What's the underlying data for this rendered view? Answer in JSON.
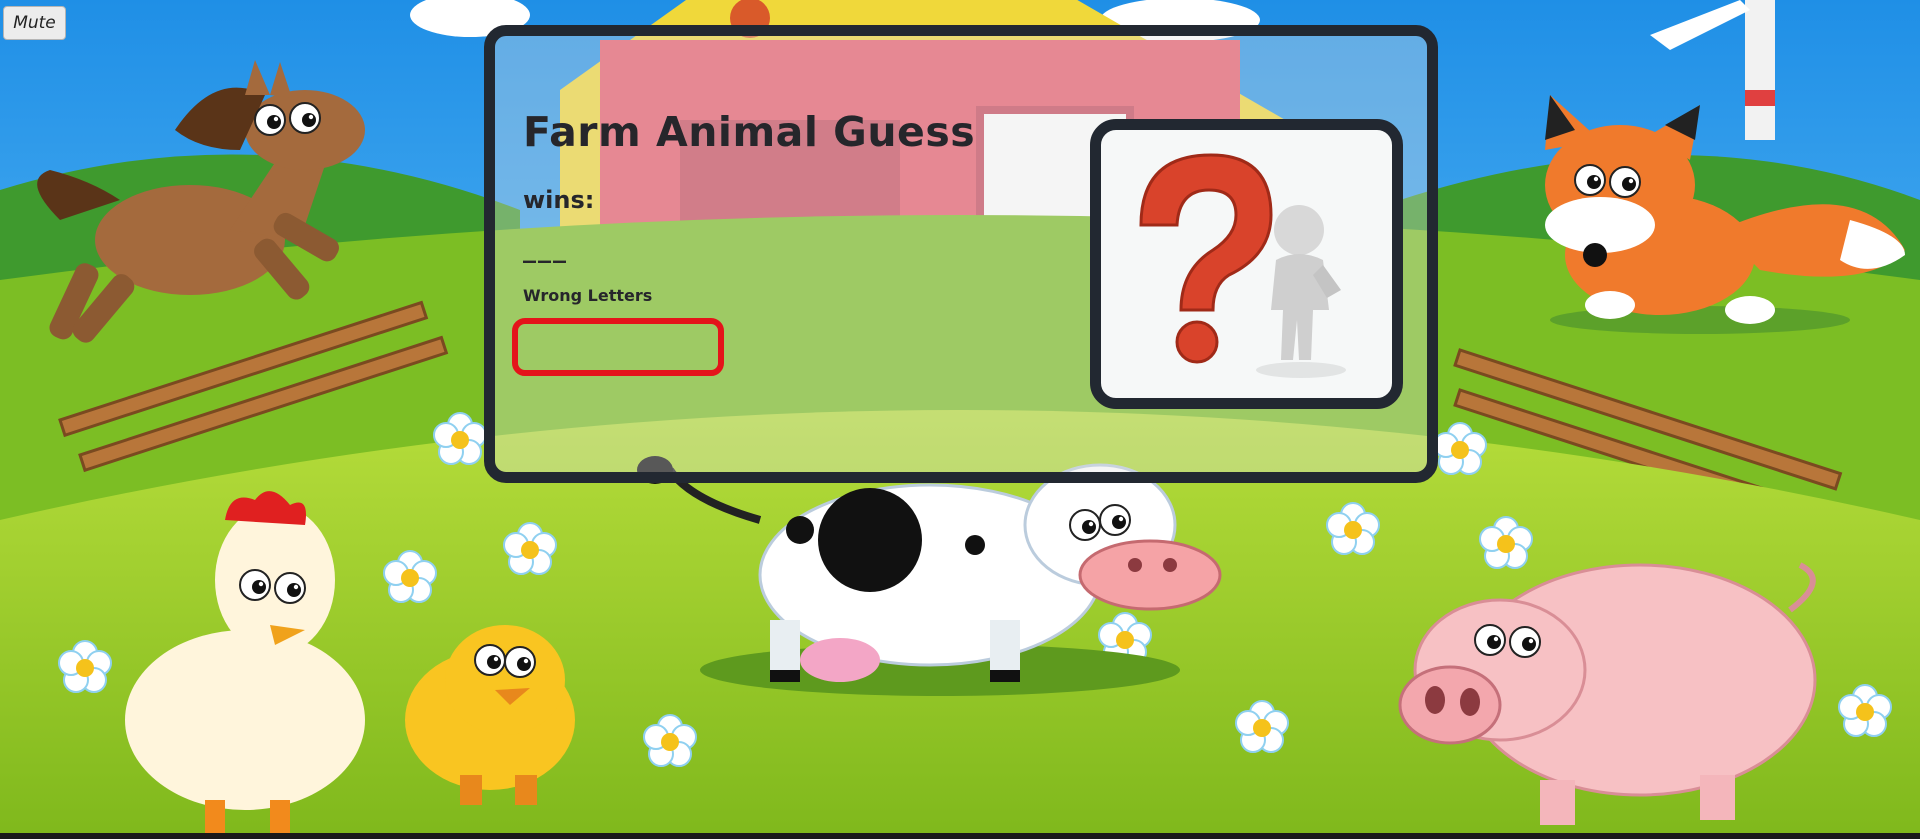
{
  "mute_button": {
    "label": "Mute"
  },
  "game": {
    "title": "Farm Animal Guess",
    "wins_label": "wins:",
    "word_display": "___",
    "wrong_letters_label": "Wrong Letters",
    "wrong_letters": ""
  },
  "mystery_image": {
    "icon": "question-mark-figure-icon"
  },
  "background": {
    "animals": [
      "horse",
      "fox",
      "cow",
      "chicken",
      "chick",
      "pig"
    ]
  },
  "colors": {
    "panel_border": "#222831",
    "wrong_box_border": "#e4141a",
    "title_text": "#26262b"
  }
}
